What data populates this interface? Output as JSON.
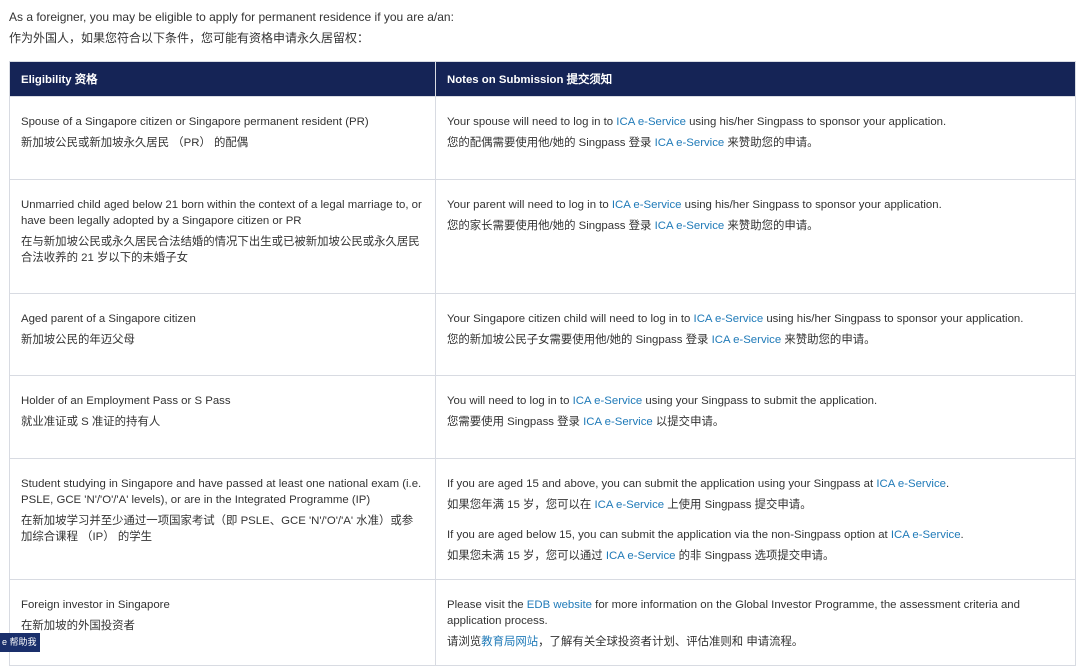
{
  "intro": {
    "line_en": "As a foreigner, you may be eligible to apply for permanent residence if you are a/an:",
    "line_zh": "作为外国人，如果您符合以下条件，您可能有资格申请永久居留权："
  },
  "table": {
    "header_eligibility": "Eligibility 资格",
    "header_notes": "Notes on Submission 提交须知",
    "link_ica": "ICA e-Service",
    "link_edb": "EDB website",
    "link_edb_zh": "教育局网站",
    "rows": [
      {
        "elig_en": "Spouse of a Singapore citizen or Singapore permanent resident (PR)",
        "elig_zh": "新加坡公民或新加坡永久居民 （PR） 的配偶",
        "note1_en_pre": "Your spouse will need to log in to ",
        "note1_en_post": " using his/her Singpass to sponsor your application.",
        "note1_zh_pre": "您的配偶需要使用他/她的 Singpass 登录 ",
        "note1_zh_post": " 来赞助您的申请。"
      },
      {
        "elig_en": "Unmarried child aged below 21 born within the context of a legal marriage to, or have been legally adopted by a Singapore citizen or PR",
        "elig_zh": "在与新加坡公民或永久居民合法结婚的情况下出生或已被新加坡公民或永久居民合法收养的 21 岁以下的未婚子女",
        "note1_en_pre": "Your parent will need to log in to ",
        "note1_en_post": " using his/her Singpass to sponsor your application.",
        "note1_zh_pre": "您的家长需要使用他/她的 Singpass 登录 ",
        "note1_zh_post": " 来赞助您的申请。"
      },
      {
        "elig_en": "Aged parent of a Singapore citizen",
        "elig_zh": "新加坡公民的年迈父母",
        "note1_en_pre": "Your Singapore citizen child will need to log in to ",
        "note1_en_post": " using his/her Singpass to sponsor your application.",
        "note1_zh_pre": "您的新加坡公民子女需要使用他/她的 Singpass 登录 ",
        "note1_zh_post": " 来赞助您的申请。"
      },
      {
        "elig_en": "Holder of an Employment Pass or S Pass",
        "elig_zh": "就业准证或 S 准证的持有人",
        "note1_en_pre": "You will need to log in to ",
        "note1_en_post": " using your Singpass to submit the application.",
        "note1_zh_pre": "您需要使用 Singpass 登录 ",
        "note1_zh_post": " 以提交申请。"
      },
      {
        "elig_en": "Student studying in Singapore and have passed at least one national exam (i.e. PSLE, GCE 'N'/'O'/'A' levels), or are in the Integrated Programme (IP)",
        "elig_zh": "在新加坡学习并至少通过一项国家考试（即 PSLE、GCE 'N'/'O'/'A' 水准）或参加综合课程 （IP） 的学生",
        "note1_en_pre": "If you are aged 15 and above, you can submit the application using your Singpass at ",
        "note1_en_post": ".",
        "note1_zh_pre": "如果您年满 15 岁，您可以在 ",
        "note1_zh_post": " 上使用 Singpass 提交申请。",
        "note2_en_pre": "If you are aged below 15, you can submit the application via the non-Singpass option at ",
        "note2_en_post": ".",
        "note2_zh_pre": "如果您未满 15 岁，您可以通过 ",
        "note2_zh_post": " 的非 Singpass 选项提交申请。"
      },
      {
        "elig_en": "Foreign investor in Singapore",
        "elig_zh": "在新加坡的外国投资者",
        "note1_en_pre": "Please visit the ",
        "note1_en_post": " for more information on the Global Investor Programme, the assessment criteria and application process.",
        "note1_zh_pre": "请浏览",
        "note1_zh_post": "，了解有关全球投资者计划、评估准则和 申请流程。"
      }
    ]
  },
  "widget": {
    "label": "e 帮助我"
  },
  "colors": {
    "header_bg": "#152456",
    "link": "#1f7ab8",
    "border": "#d8dbe2"
  }
}
